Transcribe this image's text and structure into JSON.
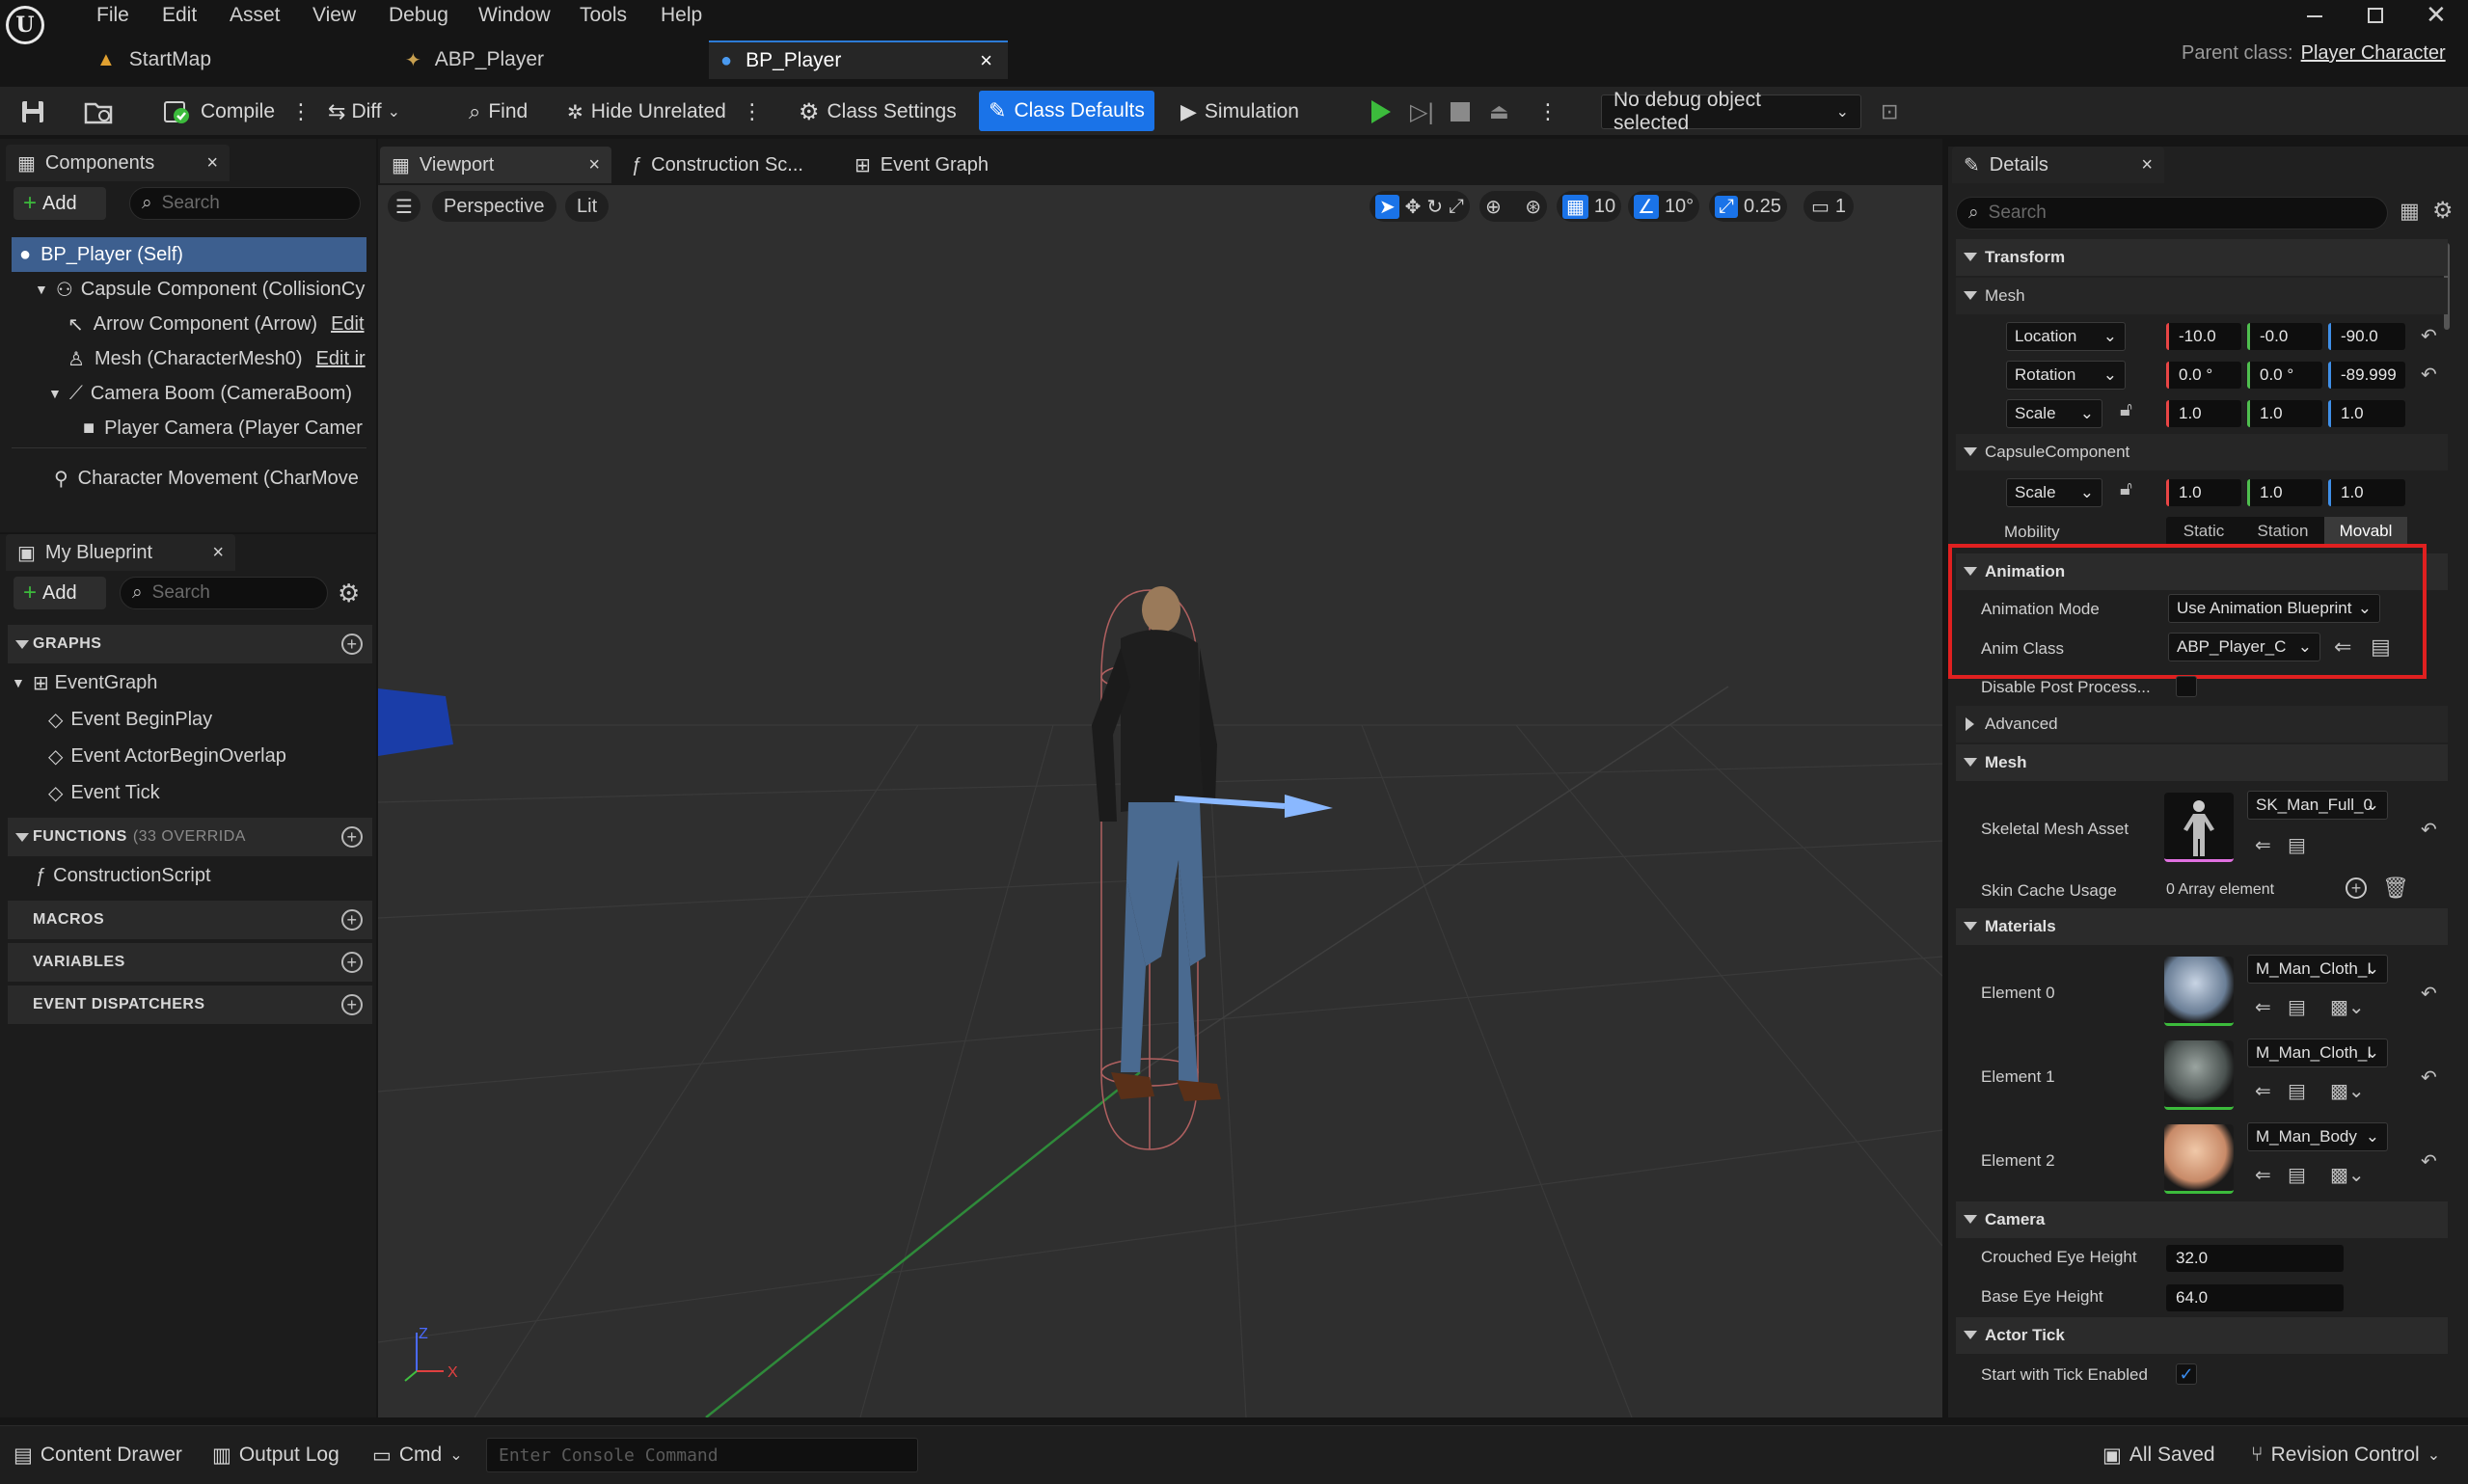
{
  "menu": [
    "File",
    "Edit",
    "Asset",
    "View",
    "Debug",
    "Window",
    "Tools",
    "Help"
  ],
  "tabs": [
    {
      "label": "StartMap"
    },
    {
      "label": "ABP_Player"
    },
    {
      "label": "BP_Player",
      "close": "×"
    }
  ],
  "parent_class": {
    "label": "Parent class:",
    "value": "Player Character"
  },
  "toolbar": {
    "compile": "Compile",
    "diff": "Diff",
    "find": "Find",
    "hide_unrelated": "Hide Unrelated",
    "class_settings": "Class Settings",
    "class_defaults": "Class Defaults",
    "simulation": "Simulation",
    "debug_object": "No debug object selected"
  },
  "components": {
    "title": "Components",
    "close": "×",
    "add": "Add",
    "search_placeholder": "Search",
    "items": [
      {
        "label": "BP_Player (Self)"
      },
      {
        "label": "Capsule Component (CollisionCy"
      },
      {
        "label": "Arrow Component (Arrow)",
        "edit": "Edit"
      },
      {
        "label": "Mesh (CharacterMesh0)",
        "edit": "Edit ir"
      },
      {
        "label": "Camera Boom (CameraBoom)"
      },
      {
        "label": "Player Camera (Player Camer"
      },
      {
        "label": "Character Movement (CharMove"
      }
    ]
  },
  "my_blueprint": {
    "title": "My Blueprint",
    "close": "×",
    "add": "Add",
    "search_placeholder": "Search",
    "graphs_header": "GRAPHS",
    "graphs": [
      {
        "label": "EventGraph"
      },
      {
        "label": "Event BeginPlay"
      },
      {
        "label": "Event ActorBeginOverlap"
      },
      {
        "label": "Event Tick"
      }
    ],
    "functions_header": "FUNCTIONS",
    "functions_note": "(33 OVERRIDA",
    "functions": [
      {
        "label": "ConstructionScript"
      }
    ],
    "macros": "MACROS",
    "variables": "VARIABLES",
    "dispatchers": "EVENT DISPATCHERS"
  },
  "editor_tabs": [
    {
      "label": "Viewport",
      "close": "×"
    },
    {
      "label": "Construction Sc..."
    },
    {
      "label": "Event Graph"
    }
  ],
  "viewport": {
    "perspective": "Perspective",
    "lit": "Lit",
    "grid_snap": "10",
    "rot_snap": "10°",
    "scale_snap": "0.25",
    "camera_speed": "1"
  },
  "details": {
    "title": "Details",
    "close": "×",
    "search_placeholder": "Search",
    "transform": "Transform",
    "mesh_sub": "Mesh",
    "location": {
      "label": "Location",
      "x": "-10.0",
      "y": "-0.0",
      "z": "-90.0"
    },
    "rotation": {
      "label": "Rotation",
      "x": "0.0 °",
      "y": "0.0 °",
      "z": "-89.999"
    },
    "scale": {
      "label": "Scale",
      "x": "1.0",
      "y": "1.0",
      "z": "1.0"
    },
    "capsule_sub": "CapsuleComponent",
    "capsule_scale": {
      "label": "Scale",
      "x": "1.0",
      "y": "1.0",
      "z": "1.0"
    },
    "mobility": {
      "label": "Mobility",
      "options": [
        "Static",
        "Station",
        "Movabl"
      ]
    },
    "animation": {
      "header": "Animation",
      "mode_label": "Animation Mode",
      "mode_value": "Use Animation Blueprint",
      "class_label": "Anim Class",
      "class_value": "ABP_Player_C",
      "highlight_color": "#e02020"
    },
    "disable_post": "Disable Post Process...",
    "advanced": "Advanced",
    "mesh": {
      "header": "Mesh",
      "skeletal_label": "Skeletal Mesh Asset",
      "skeletal_value": "SK_Man_Full_0",
      "skin_label": "Skin Cache Usage",
      "skin_value": "0 Array element"
    },
    "materials": {
      "header": "Materials",
      "elements": [
        {
          "label": "Element 0",
          "value": "M_Man_Cloth_I"
        },
        {
          "label": "Element 1",
          "value": "M_Man_Cloth_I"
        },
        {
          "label": "Element 2",
          "value": "M_Man_Body"
        }
      ]
    },
    "camera": {
      "header": "Camera",
      "crouched_label": "Crouched Eye Height",
      "crouched_value": "32.0",
      "base_label": "Base Eye Height",
      "base_value": "64.0"
    },
    "actor_tick": {
      "header": "Actor Tick",
      "start_label": "Start with Tick Enabled",
      "start_checked": true
    }
  },
  "bottom": {
    "content_drawer": "Content Drawer",
    "output_log": "Output Log",
    "cmd": "Cmd",
    "console_placeholder": "Enter Console Command",
    "all_saved": "All Saved",
    "revision": "Revision Control"
  },
  "colors": {
    "accent": "#1a73e8",
    "play": "#3cbb3c",
    "highlight": "#e02020",
    "selected_row": "#3d5f8f"
  }
}
